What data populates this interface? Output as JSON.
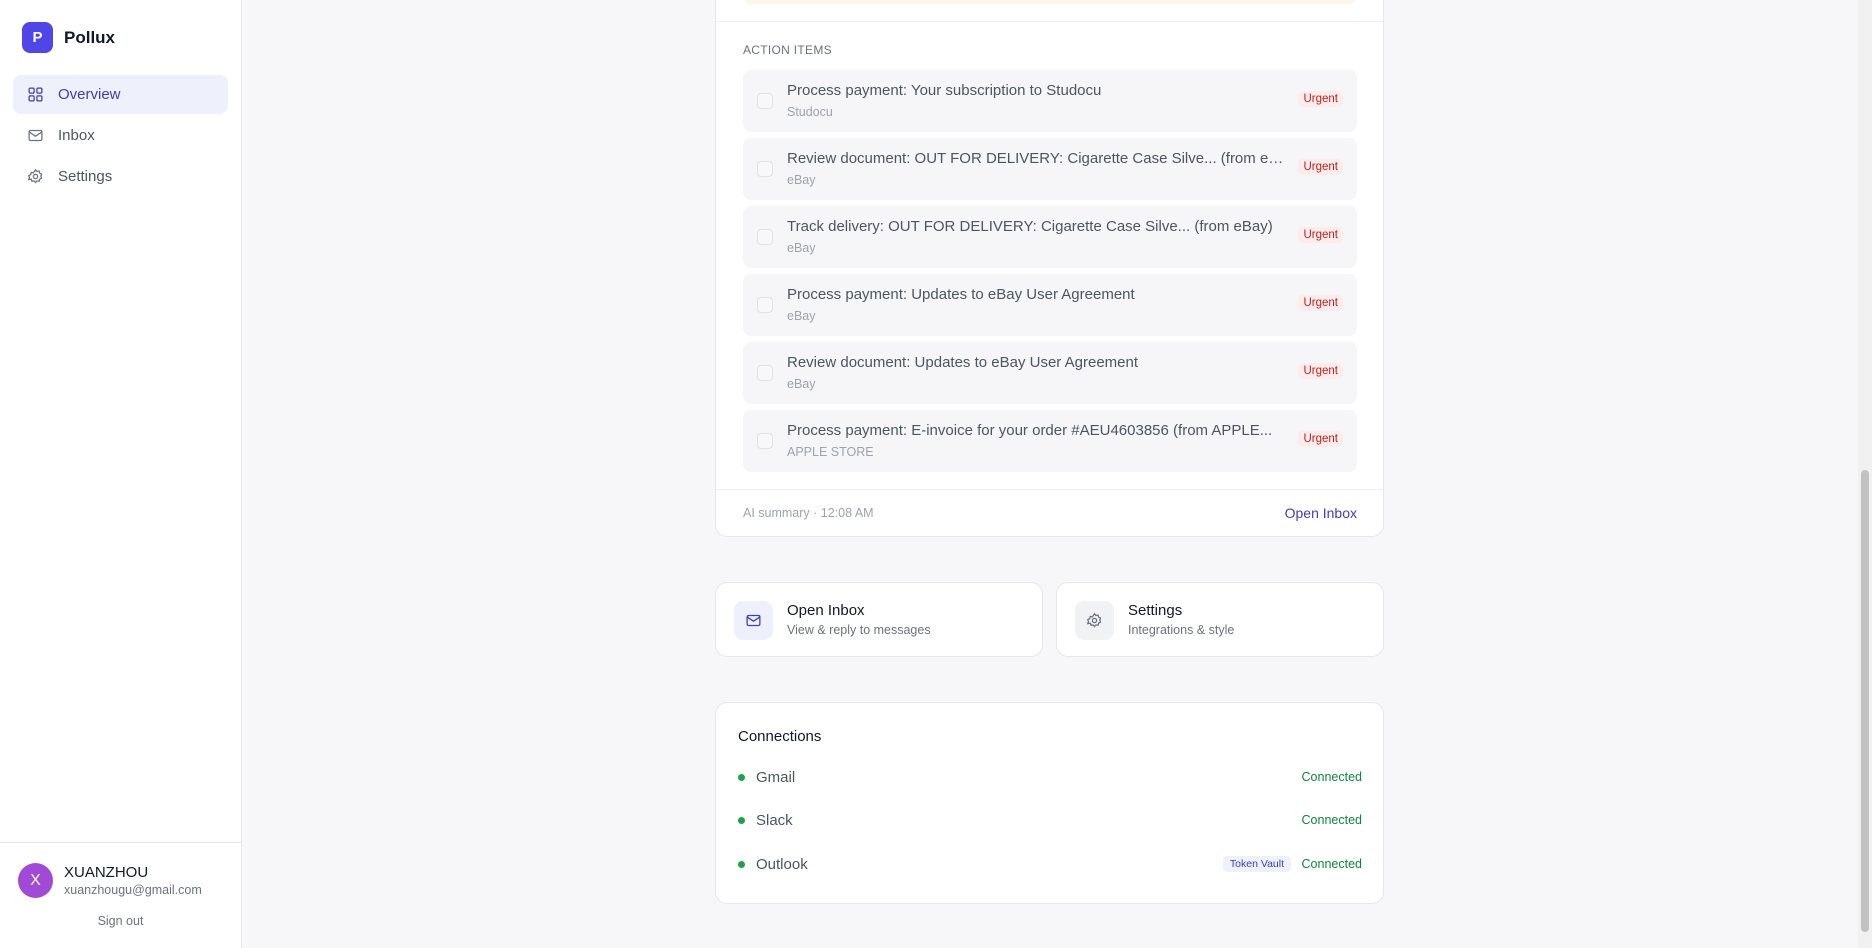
{
  "brand": {
    "logo_letter": "P",
    "name": "Pollux"
  },
  "nav": {
    "items": [
      {
        "label": "Overview",
        "icon": "grid-icon",
        "active": true
      },
      {
        "label": "Inbox",
        "icon": "mail-icon",
        "active": false
      },
      {
        "label": "Settings",
        "icon": "gear-icon",
        "active": false
      }
    ]
  },
  "user": {
    "initial": "X",
    "name": "XUANZHOU",
    "email": "xuanzhougu@gmail.com",
    "signout_label": "Sign out"
  },
  "summary": {
    "section_label": "ACTION ITEMS",
    "items": [
      {
        "title": "Process payment: Your subscription to Studocu",
        "source": "Studocu",
        "badge": "Urgent"
      },
      {
        "title": "Review document: OUT FOR DELIVERY: Cigarette Case Silve... (from eB...",
        "source": "eBay",
        "badge": "Urgent"
      },
      {
        "title": "Track delivery: OUT FOR DELIVERY: Cigarette Case Silve... (from eBay)",
        "source": "eBay",
        "badge": "Urgent"
      },
      {
        "title": "Process payment: Updates to eBay User Agreement",
        "source": "eBay",
        "badge": "Urgent"
      },
      {
        "title": "Review document: Updates to eBay User Agreement",
        "source": "eBay",
        "badge": "Urgent"
      },
      {
        "title": "Process payment: E-invoice for your order #AEU4603856 (from APPLE...",
        "source": "APPLE STORE",
        "badge": "Urgent"
      }
    ],
    "footer_text": "AI summary · 12:08 AM",
    "open_inbox_label": "Open Inbox"
  },
  "quick_actions": {
    "inbox": {
      "title": "Open Inbox",
      "subtitle": "View & reply to messages",
      "icon": "mail-icon"
    },
    "settings": {
      "title": "Settings",
      "subtitle": "Integrations & style",
      "icon": "gear-icon"
    }
  },
  "connections": {
    "title": "Connections",
    "items": [
      {
        "name": "Gmail",
        "status": "Connected",
        "badge": ""
      },
      {
        "name": "Slack",
        "status": "Connected",
        "badge": ""
      },
      {
        "name": "Outlook",
        "status": "Connected",
        "badge": "Token Vault"
      }
    ]
  },
  "colors": {
    "accent": "#4f46e5",
    "urgent": "#b42323",
    "connected": "#16803d",
    "avatar": "#a14ad6"
  }
}
